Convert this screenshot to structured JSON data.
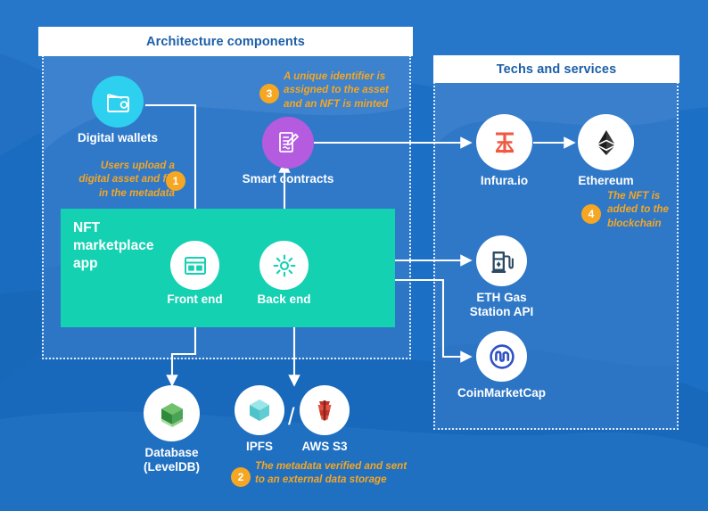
{
  "panels": {
    "architecture": {
      "title": "Architecture components"
    },
    "techs": {
      "title": "Techs and services"
    }
  },
  "app_block": {
    "label": "NFT\nmarketplace\napp"
  },
  "nodes": {
    "digital_wallets": {
      "label": "Digital wallets",
      "icon": "wallet-icon",
      "color": "#2ed0f0"
    },
    "smart_contracts": {
      "label": "Smart contracts",
      "icon": "contract-document-pen-icon",
      "color": "#b45be0"
    },
    "front_end": {
      "label": "Front end",
      "icon": "browser-layout-icon",
      "color": "#ffffff"
    },
    "back_end": {
      "label": "Back end",
      "icon": "gear-icon",
      "color": "#ffffff"
    },
    "database": {
      "label": "Database\n(LevelDB)",
      "icon": "leveldb-cube-icon",
      "color": "#ffffff"
    },
    "ipfs": {
      "label": "IPFS",
      "icon": "ipfs-cube-icon",
      "color": "#ffffff"
    },
    "aws_s3": {
      "label": "AWS S3",
      "icon": "aws-s3-bucket-icon",
      "color": "#ffffff"
    },
    "infura": {
      "label": "Infura.io",
      "icon": "infura-logo-icon",
      "color": "#ffffff"
    },
    "ethereum": {
      "label": "Ethereum",
      "icon": "ethereum-diamond-icon",
      "color": "#ffffff"
    },
    "eth_gas_station": {
      "label": "ETH Gas\nStation API",
      "icon": "gas-pump-icon",
      "color": "#ffffff"
    },
    "coinmarketcap": {
      "label": "CoinMarketCap",
      "icon": "coinmarketcap-logo-icon",
      "color": "#ffffff"
    }
  },
  "separator": {
    "label": "/"
  },
  "steps": [
    {
      "number": "1",
      "text": "Users upload a\ndigital asset and fill\nin the metadata"
    },
    {
      "number": "2",
      "text": "The metadata verified and sent\nto an external data storage"
    },
    {
      "number": "3",
      "text": "A unique identifier is\nassigned to the asset\nand an NFT is minted"
    },
    {
      "number": "4",
      "text": "The NFT is\nadded to the\nblockchain"
    }
  ],
  "colors": {
    "background": "#1b6fc4",
    "panel": "#3079c9",
    "app_block": "#14d1b2",
    "accent_orange": "#f5a623",
    "title_text": "#1c5fa8",
    "wallet": "#2ed0f0",
    "smart_contract": "#b45be0",
    "infura": "#f05a42",
    "coinmarketcap": "#2f52c4",
    "aws": "#d9452f",
    "leveldb": "#3f9c4a",
    "ipfs": "#5bc8cf"
  }
}
